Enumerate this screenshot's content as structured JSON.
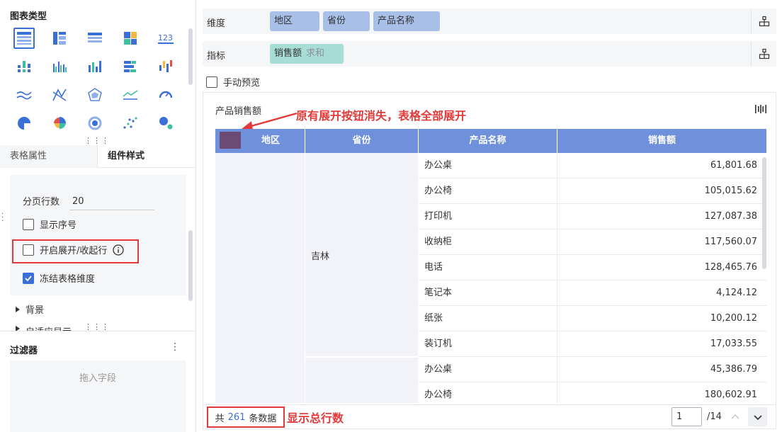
{
  "left_panel": {
    "chart_type_title": "图表类型",
    "chart_types": [
      {
        "icon": "table-detail-icon"
      },
      {
        "icon": "table-group-icon"
      },
      {
        "icon": "table-cross-icon"
      },
      {
        "icon": "treemap-icon"
      },
      {
        "icon": "kpi-number-icon"
      },
      {
        "icon": "bar-stacked-icon"
      },
      {
        "icon": "bar-grouped-icon"
      },
      {
        "icon": "bar-chart-icon"
      },
      {
        "icon": "bar-horizontal-icon"
      },
      {
        "icon": "bar-diverging-icon"
      },
      {
        "icon": "line-chart-icon"
      },
      {
        "icon": "combo-chart-icon"
      },
      {
        "icon": "radar-chart-icon"
      },
      {
        "icon": "area-chart-icon"
      },
      {
        "icon": "gauge-icon"
      },
      {
        "icon": "pie-chart-icon"
      },
      {
        "icon": "rose-chart-icon"
      },
      {
        "icon": "ring-chart-icon"
      },
      {
        "icon": "scatter-icon"
      },
      {
        "icon": "bubble-icon"
      }
    ],
    "tabs": [
      "表格属性",
      "组件样式"
    ],
    "style": {
      "paging_label": "分页行数",
      "paging_value": "20",
      "show_index_label": "显示序号",
      "show_index_checked": false,
      "expand_collapse_label": "开启展开/收起行",
      "expand_collapse_checked": false,
      "freeze_dim_label": "冻结表格维度",
      "freeze_dim_checked": true,
      "background_label": "背景",
      "adaptive_label": "自适应显示"
    },
    "filter": {
      "title": "过滤器",
      "menu": "⋮",
      "drop_placeholder": "拖入字段"
    }
  },
  "right_panel": {
    "dimension": {
      "label": "维度",
      "fields": [
        "地区",
        "省份",
        "产品名称"
      ]
    },
    "metric": {
      "label": "指标",
      "fields": [
        {
          "name": "销售额",
          "agg": "求和"
        }
      ]
    },
    "manual_preview_label": "手动预览",
    "manual_preview_checked": false,
    "chart": {
      "title": "产品销售额",
      "annotation_top": "原有展开按钮消失，表格全部展开",
      "annotation_bottom": "显示总行数",
      "columns": [
        "地区",
        "省份",
        "产品名称",
        "销售额"
      ],
      "swatch_color": "#6b4a73",
      "header_color": "#6f90da",
      "province": "吉林",
      "rows": [
        {
          "name": "办公桌",
          "sales": "61,801.68"
        },
        {
          "name": "办公椅",
          "sales": "105,015.62"
        },
        {
          "name": "打印机",
          "sales": "127,087.38"
        },
        {
          "name": "收纳柜",
          "sales": "117,560.07"
        },
        {
          "name": "电话",
          "sales": "128,465.76"
        },
        {
          "name": "笔记本",
          "sales": "4,124.12"
        },
        {
          "name": "纸张",
          "sales": "10,200.12"
        },
        {
          "name": "装订机",
          "sales": "17,033.55"
        },
        {
          "name": "办公桌",
          "sales": "45,386.79"
        },
        {
          "name": "办公椅",
          "sales": "180,602.91"
        }
      ]
    },
    "footer": {
      "total_prefix": "共",
      "total_count": "261",
      "total_suffix": "条数据",
      "page_current": "1",
      "page_total": "/14"
    }
  }
}
